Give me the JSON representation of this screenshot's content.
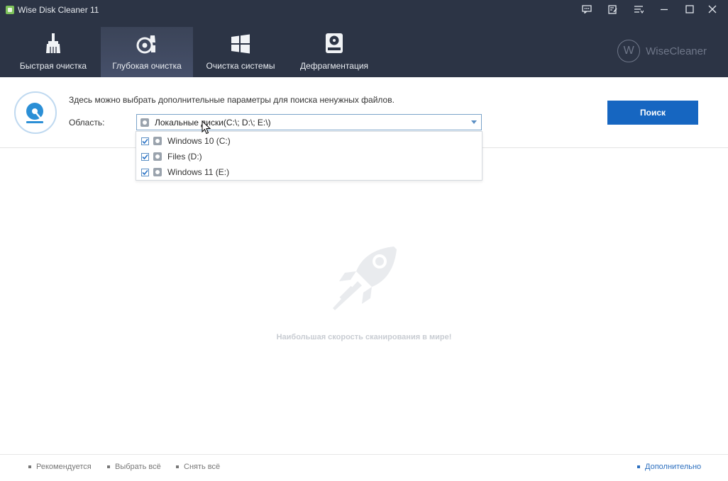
{
  "window": {
    "title": "Wise Disk Cleaner 11",
    "controls": [
      "feedback-icon",
      "notes-icon",
      "menu-icon",
      "minimize-icon",
      "maximize-icon",
      "close-icon"
    ]
  },
  "nav": {
    "tabs": [
      {
        "label": "Быстрая очистка",
        "icon": "broom-icon",
        "active": false
      },
      {
        "label": "Глубокая очистка",
        "icon": "deep-clean-icon",
        "active": true
      },
      {
        "label": "Очистка системы",
        "icon": "windows-icon",
        "active": false
      },
      {
        "label": "Дефрагментация",
        "icon": "defrag-drive-icon",
        "active": false
      }
    ],
    "brand": "WiseCleaner",
    "brand_mark": "W"
  },
  "options": {
    "description": "Здесь можно выбрать дополнительные параметры для поиска ненужных файлов.",
    "area_label": "Область:",
    "area_value": "Локальные диски(C:\\; D:\\; E:\\)",
    "search_button": "Поиск",
    "drives": [
      {
        "label": "Windows 10 (C:)",
        "checked": true
      },
      {
        "label": "Files (D:)",
        "checked": true
      },
      {
        "label": "Windows 11 (E:)",
        "checked": true
      }
    ]
  },
  "empty_state": {
    "message": "Наибольшая скорость сканирования в мире!"
  },
  "footer": {
    "recommended": "Рекомендуется",
    "select_all": "Выбрать всё",
    "deselect_all": "Снять всё",
    "advanced": "Дополнительно"
  },
  "colors": {
    "header_bg": "#2c3445",
    "accent": "#1666c1",
    "link": "#2c6fbf"
  }
}
